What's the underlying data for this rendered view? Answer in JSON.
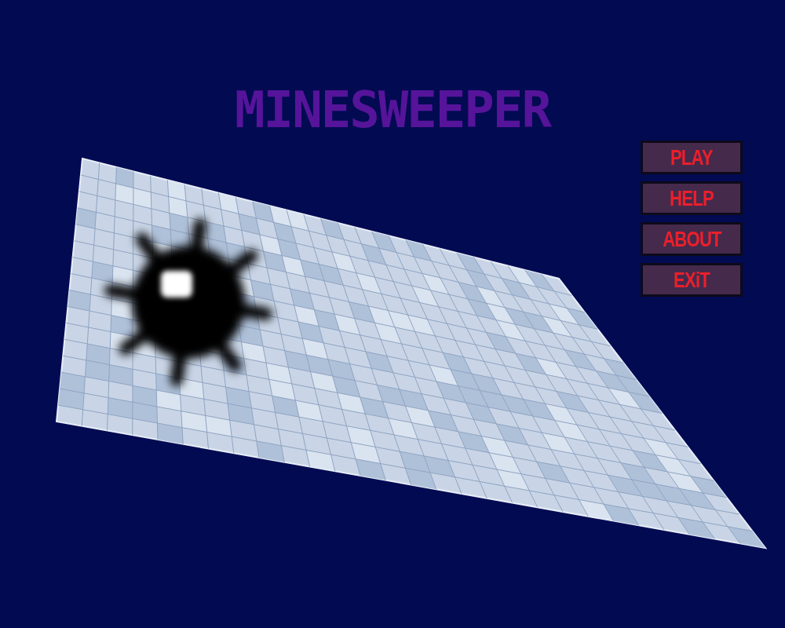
{
  "title": "MINESWEEPER",
  "menu": [
    {
      "label": "PLAY"
    },
    {
      "label": "HELP"
    },
    {
      "label": "ABOUT"
    },
    {
      "label": "EXiT"
    }
  ]
}
